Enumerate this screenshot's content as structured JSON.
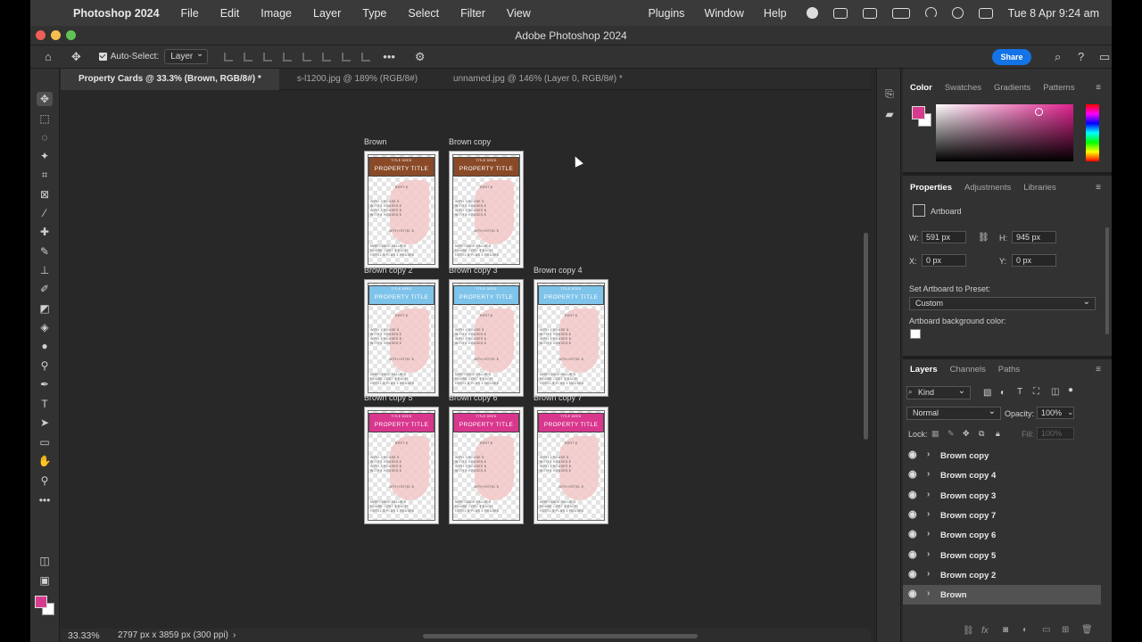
{
  "menubar": {
    "app": "Photoshop 2024",
    "menus": [
      "File",
      "Edit",
      "Image",
      "Layer",
      "Type",
      "Select",
      "Filter",
      "View"
    ],
    "right_menus": [
      "Plugins",
      "Window",
      "Help"
    ],
    "clock": "Tue 8 Apr  9:24 am"
  },
  "window": {
    "title": "Adobe Photoshop 2024"
  },
  "options": {
    "auto_select_label": "Auto-Select:",
    "auto_select_value": "Layer",
    "share_label": "Share"
  },
  "tabs": [
    {
      "label": "Property Cards @ 33.3% (Brown, RGB/8#) *"
    },
    {
      "label": "s-l1200.jpg @ 189% (RGB/8#)"
    },
    {
      "label": "unnamed.jpg @ 146% (Layer 0, RGB/8#) *"
    }
  ],
  "artboards": [
    {
      "label": "Brown",
      "color": "#8a4a28"
    },
    {
      "label": "Brown copy",
      "color": "#8a4a28"
    },
    {
      "label": "Brown copy 2",
      "color": "#7ec3ea"
    },
    {
      "label": "Brown copy 3",
      "color": "#7ec3ea"
    },
    {
      "label": "Brown copy 4",
      "color": "#7ec3ea"
    },
    {
      "label": "Brown copy 5",
      "color": "#d9378e"
    },
    {
      "label": "Brown copy 6",
      "color": "#d9378e"
    },
    {
      "label": "Brown copy 7",
      "color": "#d9378e"
    }
  ],
  "card_text": {
    "title_deed": "TITLE DEED",
    "property_title": "PROPERTY TITLE",
    "rent": "RENT $",
    "h1": "WITH 1 HOUSE $",
    "h2": "WITH 2 HOUSES $",
    "h3": "WITH 3 HOUSES $",
    "h4": "WITH 4 HOUSES $",
    "hotel": "WITH HOTEL $",
    "mortgage": "MORTGAGE VALUE $",
    "house_cost": "HOUSE COST $    EACH",
    "hotel_cost": "HOTEL  $  PLUS 4 HOUSES"
  },
  "status": {
    "zoom": "33.33%",
    "doc_info": "2797 px x 3859 px (300 ppi)"
  },
  "color_panel": {
    "tabs": [
      "Color",
      "Swatches",
      "Gradients",
      "Patterns"
    ],
    "fg_color": "#d63c8e",
    "bg_color": "#ffffff"
  },
  "properties": {
    "tabs": [
      "Properties",
      "Adjustments",
      "Libraries"
    ],
    "type": "Artboard",
    "w_label": "W:",
    "w": "591 px",
    "h_label": "H:",
    "h": "945 px",
    "x_label": "X:",
    "x": "0 px",
    "y_label": "Y:",
    "y": "0 px",
    "preset_label": "Set Artboard to Preset:",
    "preset_value": "Custom",
    "bg_label": "Artboard background color:"
  },
  "layers_panel": {
    "tabs": [
      "Layers",
      "Channels",
      "Paths"
    ],
    "filter": "Kind",
    "blend_mode": "Normal",
    "opacity_label": "Opacity:",
    "opacity": "100%",
    "lock_label": "Lock:",
    "fill_label": "Fill:",
    "fill": "100%",
    "layers": [
      "Brown copy",
      "Brown copy 4",
      "Brown copy 3",
      "Brown copy 7",
      "Brown copy 6",
      "Brown copy 5",
      "Brown copy 2",
      "Brown"
    ],
    "selected_layer": "Brown"
  }
}
